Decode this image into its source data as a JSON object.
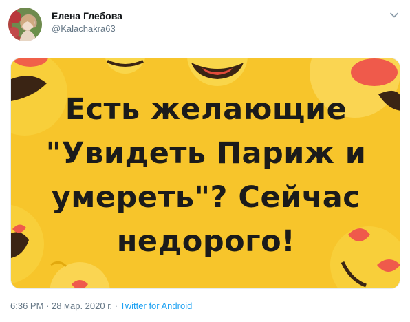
{
  "author": {
    "name": "Елена Глебова",
    "handle": "@Kalachakra63"
  },
  "media": {
    "text_lines": [
      "Есть желающие",
      "\"Увидеть Париж и",
      "умереть\"? Сейчас",
      "недорого!"
    ],
    "background_color": "#f7c52b"
  },
  "meta": {
    "time": "6:36 PM",
    "sep1": " · ",
    "date": "28 мар. 2020 г.",
    "sep2": " · ",
    "source": "Twitter for Android"
  },
  "icons": {
    "menu": "chevron-down-icon"
  },
  "colors": {
    "name": "#14171a",
    "secondary": "#657786",
    "link": "#1da1f2"
  }
}
